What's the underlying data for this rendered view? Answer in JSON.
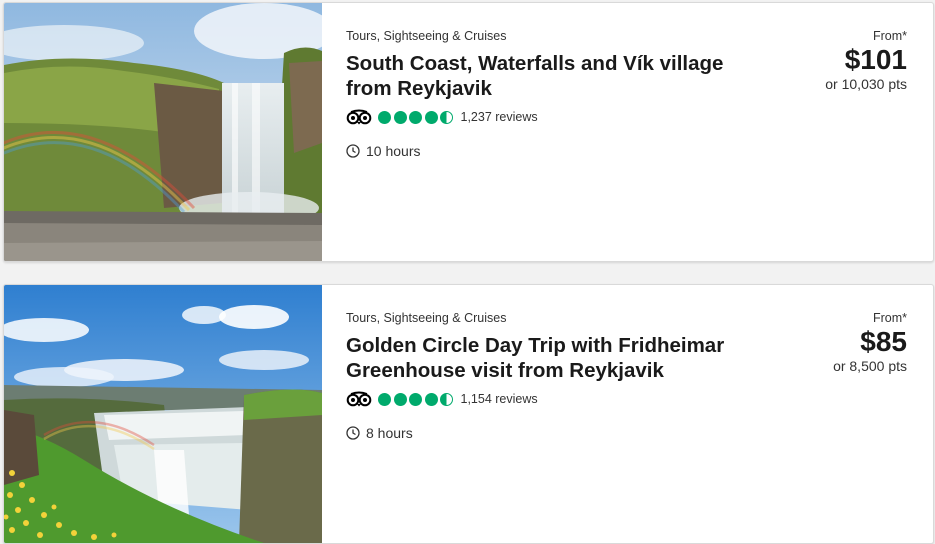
{
  "listings": [
    {
      "category": "Tours, Sightseeing & Cruises",
      "title_line1": "South Coast, Waterfalls and Vík village",
      "title_line2": "from Reykjavik",
      "rating": 4.5,
      "reviews": "1,237 reviews",
      "duration": "10 hours",
      "from_label": "From*",
      "price": "$101",
      "points": "or 10,030 pts"
    },
    {
      "category": "Tours, Sightseeing & Cruises",
      "title_line1": "Golden Circle Day Trip with Fridheimar",
      "title_line2": "Greenhouse visit from Reykjavik",
      "rating": 4.5,
      "reviews": "1,154 reviews",
      "duration": "8 hours",
      "from_label": "From*",
      "price": "$85",
      "points": "or 8,500 pts"
    }
  ],
  "colors": {
    "rating_green": "#00aa6c",
    "text": "#1a1a1a",
    "card_border": "#d9d9d9"
  },
  "icons": {
    "review_site": "tripadvisor-owl-icon",
    "duration": "clock-icon"
  }
}
